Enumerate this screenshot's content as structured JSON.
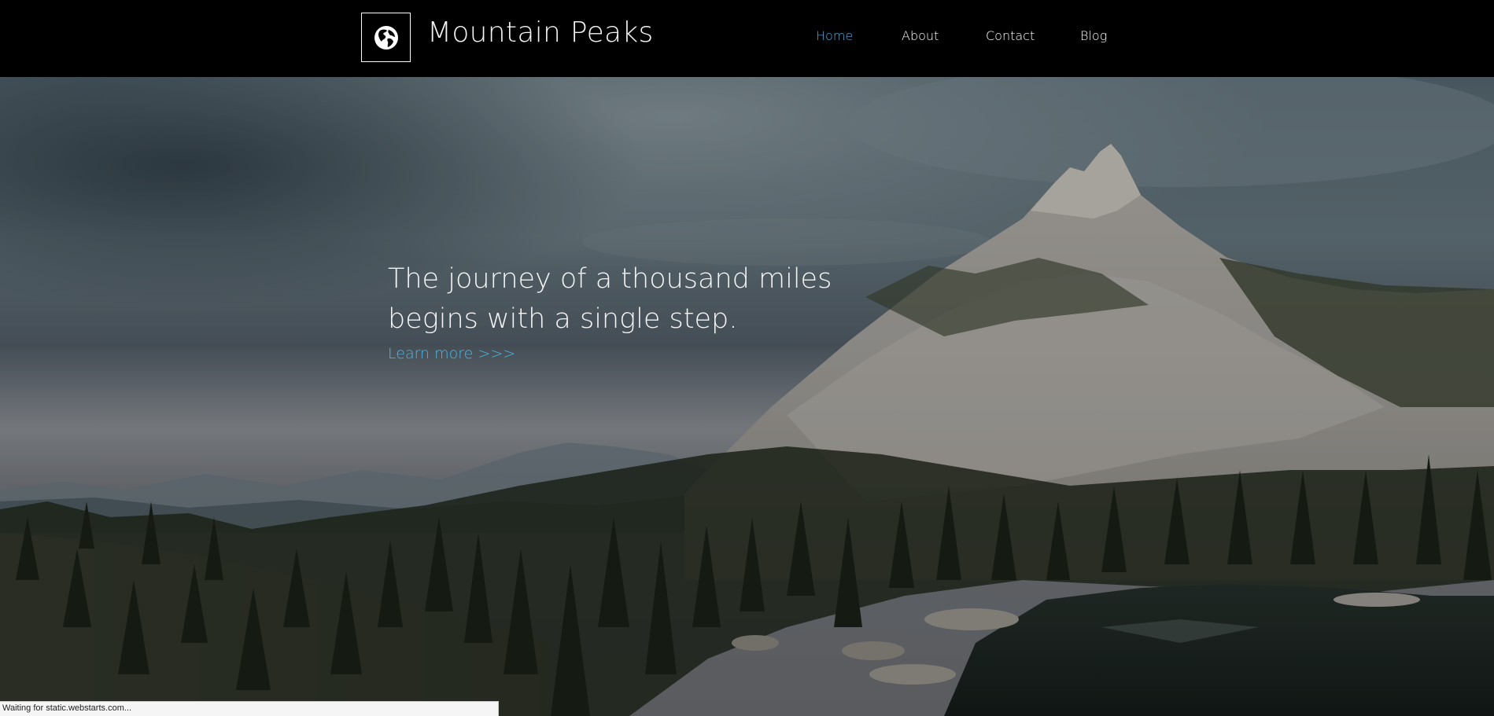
{
  "header": {
    "logo_icon": "globe-icon",
    "site_title": "Mountain Peaks",
    "nav": [
      {
        "label": "Home",
        "active": true
      },
      {
        "label": "About",
        "active": false
      },
      {
        "label": "Contact",
        "active": false
      },
      {
        "label": "Blog",
        "active": false
      }
    ]
  },
  "hero": {
    "headline_line1": "The journey of a thousand miles",
    "headline_line2": "begins with a single step.",
    "cta_label": "Learn more >>>"
  },
  "status_bar": {
    "text": "Waiting for static.webstarts.com..."
  },
  "colors": {
    "header_bg": "#000000",
    "nav_active": "#5aa9d6",
    "cta": "#4fb6e2",
    "text": "#ffffff"
  }
}
